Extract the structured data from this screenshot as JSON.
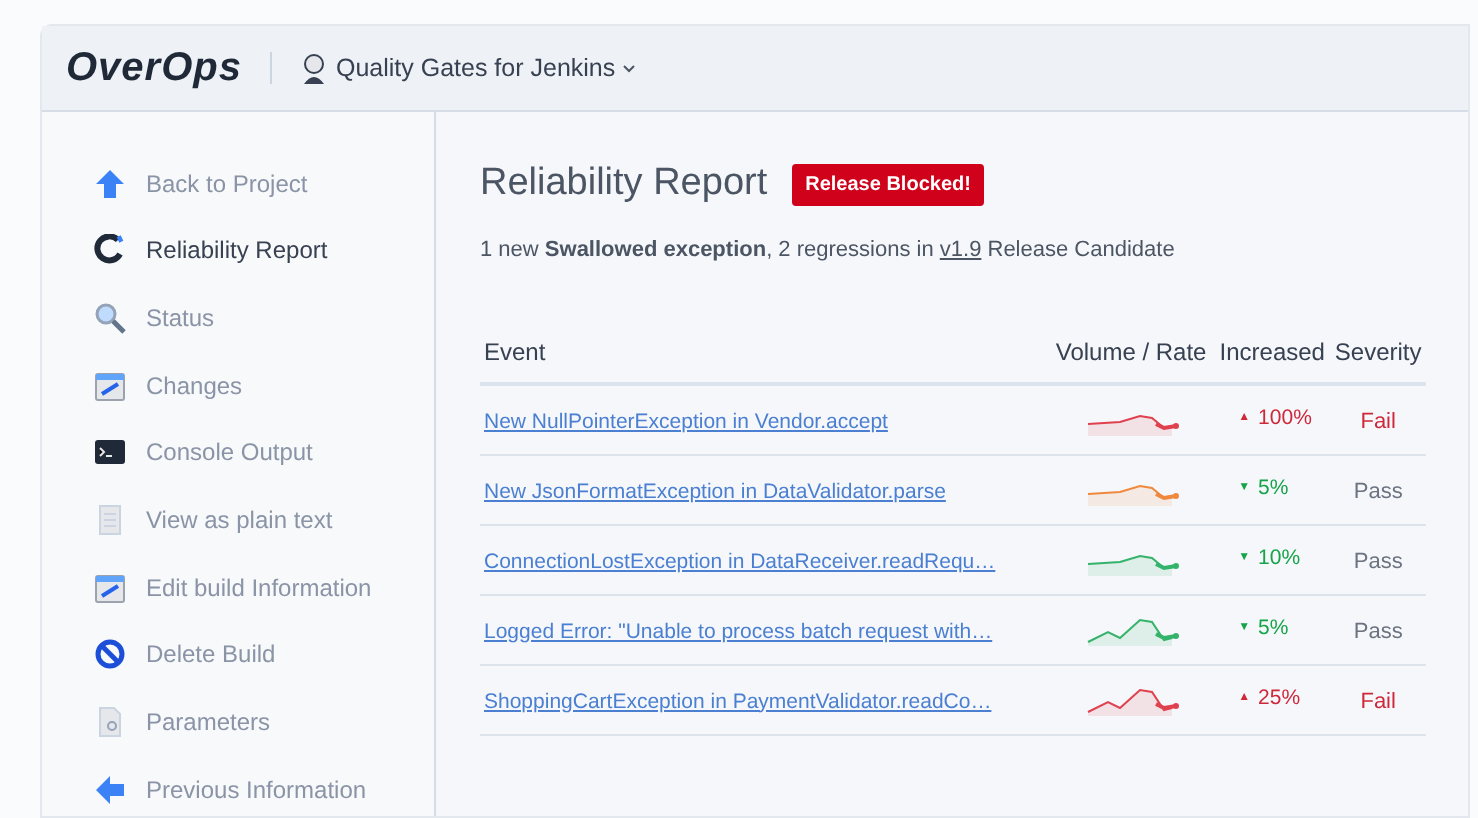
{
  "header": {
    "logo": "OverOps",
    "project": "Quality Gates for Jenkins"
  },
  "sidebar": {
    "items": [
      {
        "label": "Back to Project",
        "selected": false
      },
      {
        "label": "Reliability Report",
        "selected": true
      },
      {
        "label": "Status",
        "selected": false
      },
      {
        "label": "Changes",
        "selected": false
      },
      {
        "label": "Console Output",
        "selected": false
      },
      {
        "label": "View as plain text",
        "selected": false
      },
      {
        "label": "Edit build Information",
        "selected": false
      },
      {
        "label": "Delete Build",
        "selected": false
      },
      {
        "label": "Parameters",
        "selected": false
      },
      {
        "label": "Previous Information",
        "selected": false
      }
    ]
  },
  "report": {
    "title": "Reliability Report",
    "badge": "Release Blocked!",
    "summary": "1 new **Swallowed exception**, 2 regressions in ",
    "version": "v1.9",
    "summary_end": " Release Candidate",
    "table": {
      "columns": [
        "Event",
        "Volume / Rate",
        "Increased",
        "Severity"
      ],
      "rows": [
        {
          "event": "New NullPointerException in Vendor.accept",
          "color": "#e0414f",
          "arrow": "▲",
          "increased": "100%",
          "severity": "Fail",
          "kind": "fail"
        },
        {
          "event": "New JsonFormatException in DataValidator.parse",
          "color": "#f0883e",
          "arrow": "▼",
          "increased": "5%",
          "severity": "Pass",
          "kind": "pass"
        },
        {
          "event": "ConnectionLostException in DataReceiver.readRequ…",
          "color": "#34b36a",
          "arrow": "▼",
          "increased": "10%",
          "severity": "Pass",
          "kind": "pass"
        },
        {
          "event": "Logged Error: \"Unable to process batch request with…",
          "color": "#34b36a",
          "arrow": "▼",
          "increased": "5%",
          "severity": "Pass",
          "kind": "pass"
        },
        {
          "event": "ShoppingCartException in PaymentValidator.readCo…",
          "color": "#e0414f",
          "arrow": "▲",
          "increased": "25%",
          "severity": "Fail",
          "kind": "fail"
        }
      ]
    }
  }
}
